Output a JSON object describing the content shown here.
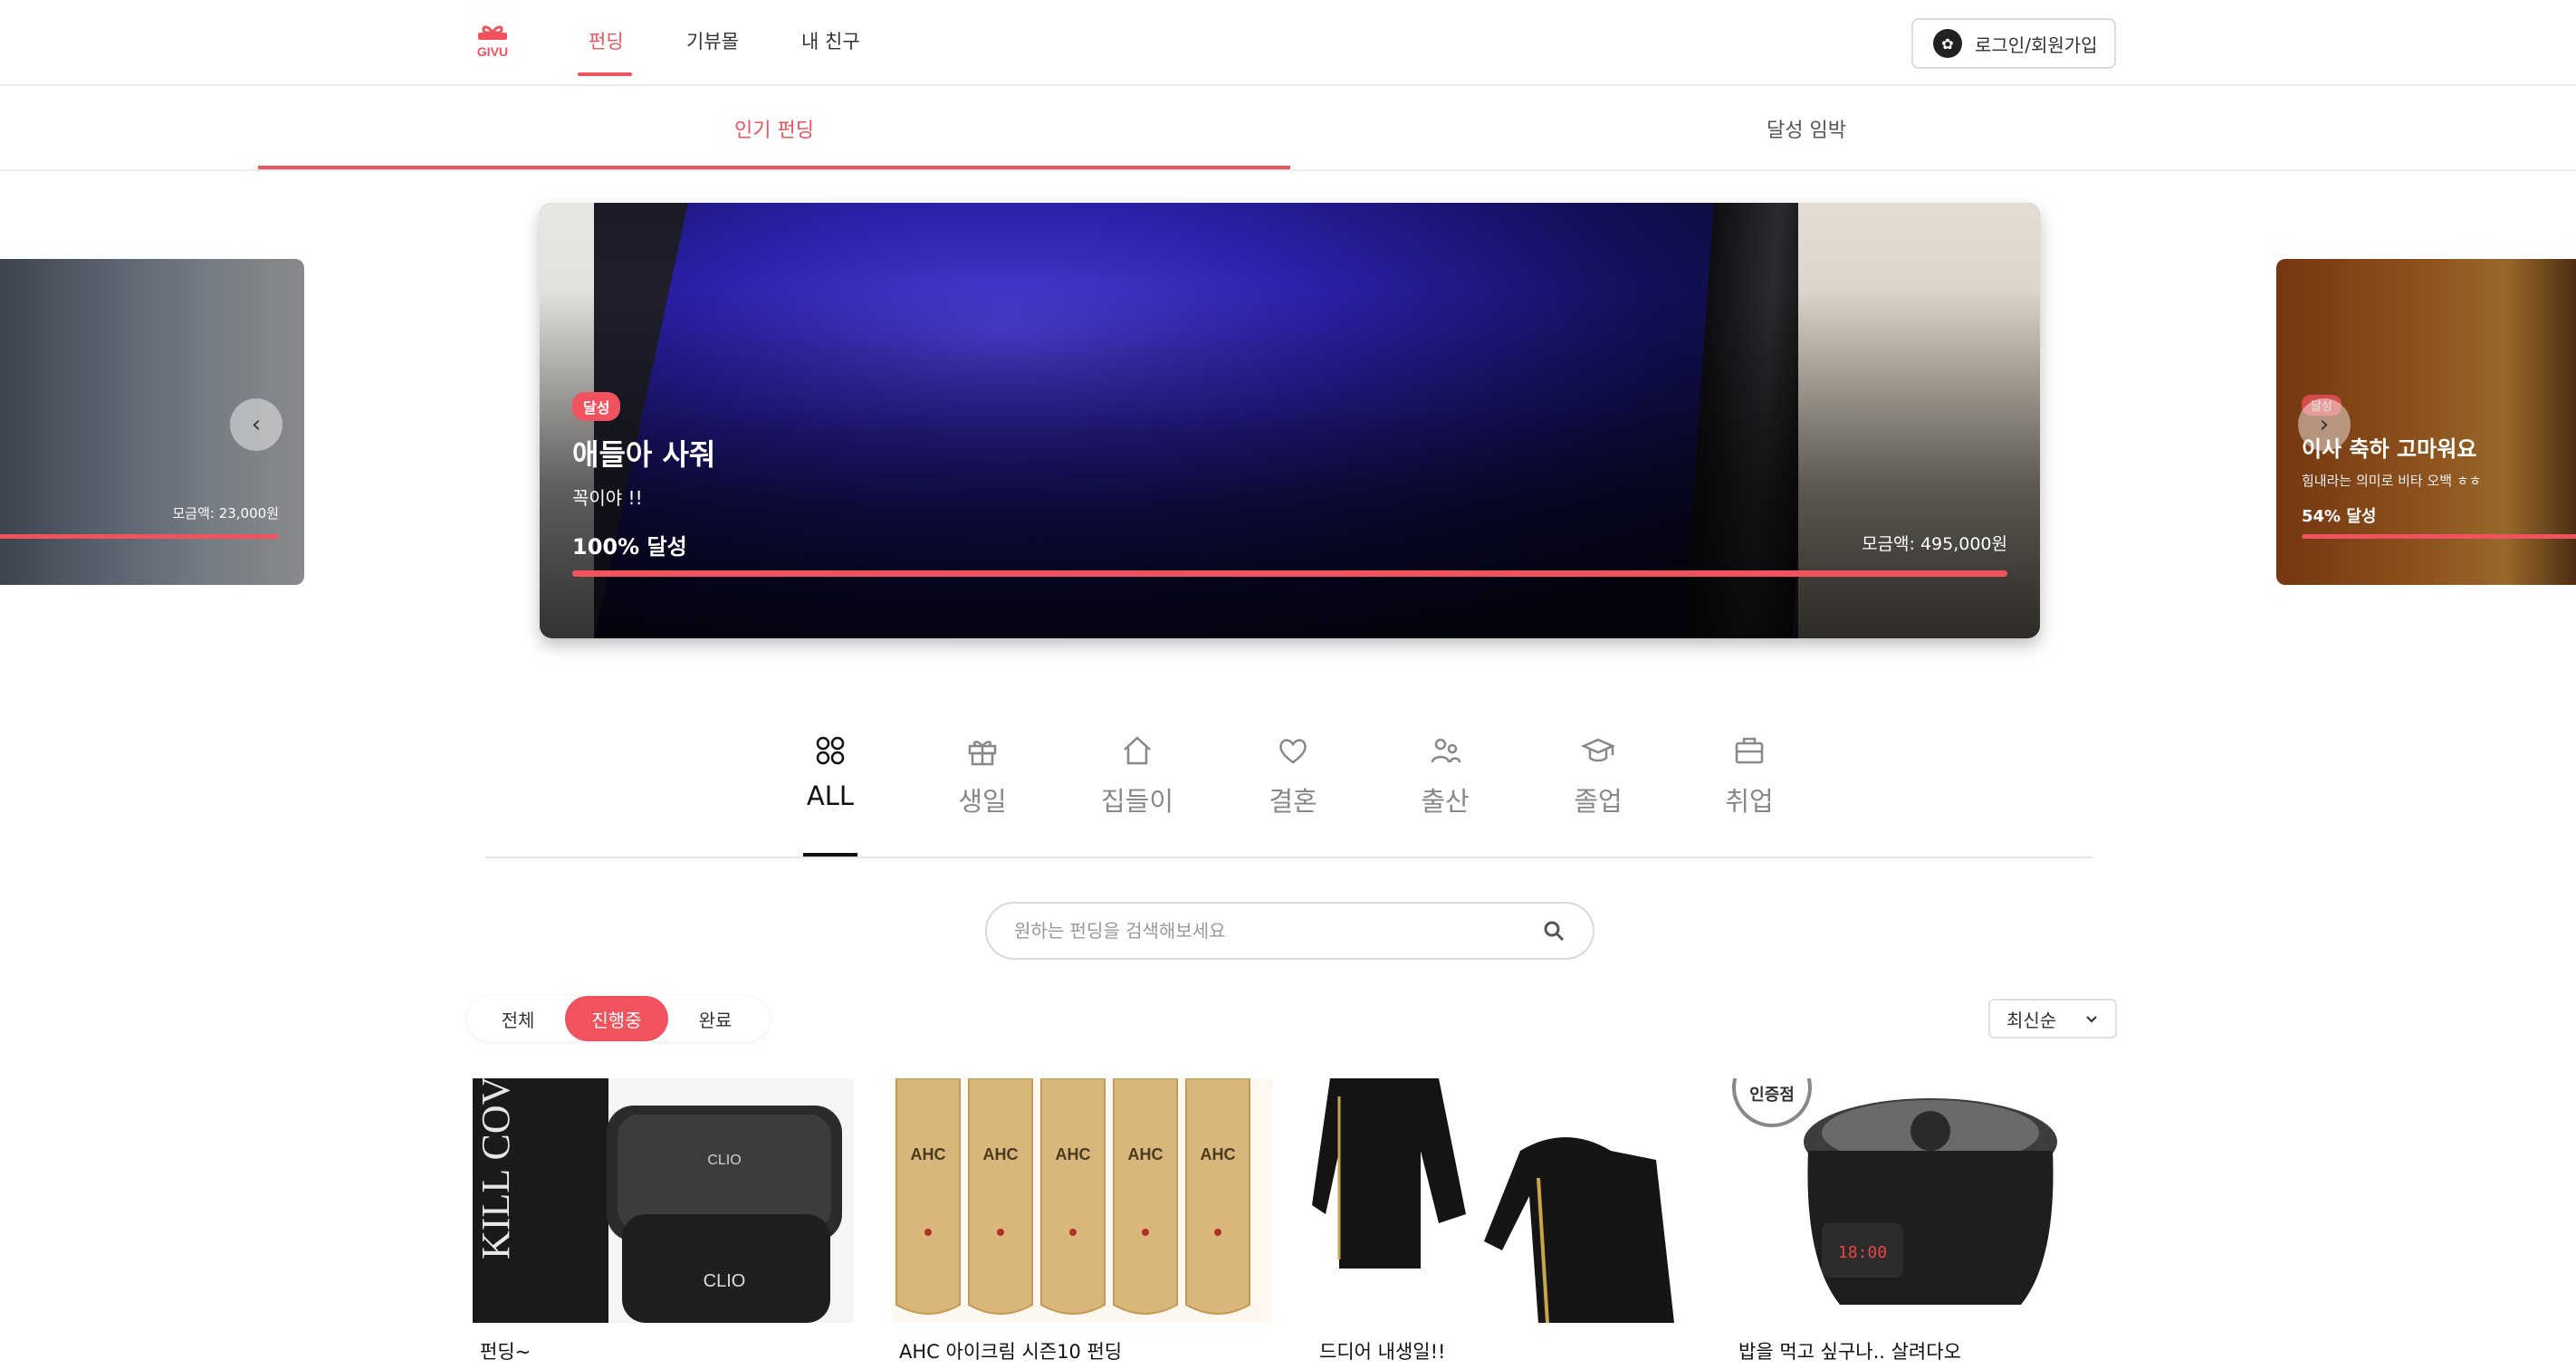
{
  "header": {
    "logo_text": "GIVU",
    "nav": [
      {
        "label": "펀딩",
        "active": true
      },
      {
        "label": "기뷰몰",
        "active": false
      },
      {
        "label": "내 친구",
        "active": false
      }
    ],
    "login_label": "로그인/회원가입"
  },
  "tabs": [
    {
      "label": "인기 펀딩",
      "active": true
    },
    {
      "label": "달성 임박",
      "active": false
    }
  ],
  "carousel": {
    "left_card": {
      "amount": "모금액: 23,000원",
      "progress_percent": 100
    },
    "main_card": {
      "badge": "달성",
      "title": "애들아 사줘",
      "subtitle": "꼭이야 !!",
      "progress_text": "100% 달성",
      "amount": "모금액: 495,000원",
      "progress_percent": 100
    },
    "right_card": {
      "badge": "달성",
      "title": "이사 축하 고마워요",
      "subtitle": "힘내라는 의미로 비타 오백 ㅎㅎ",
      "progress_text": "54% 달성",
      "progress_percent": 54
    },
    "prev_icon": "chevron-left-icon",
    "next_icon": "chevron-right-icon"
  },
  "categories": [
    {
      "label": "ALL",
      "icon": "grid-icon",
      "active": true
    },
    {
      "label": "생일",
      "icon": "gift-icon",
      "active": false
    },
    {
      "label": "집들이",
      "icon": "house-icon",
      "active": false
    },
    {
      "label": "결혼",
      "icon": "heart-icon",
      "active": false
    },
    {
      "label": "출산",
      "icon": "people-icon",
      "active": false
    },
    {
      "label": "졸업",
      "icon": "graduation-cap-icon",
      "active": false
    },
    {
      "label": "취업",
      "icon": "briefcase-icon",
      "active": false
    }
  ],
  "search": {
    "placeholder": "원하는 펀딩을 검색해보세요"
  },
  "filters": [
    {
      "label": "전체",
      "active": false
    },
    {
      "label": "진행중",
      "active": true
    },
    {
      "label": "완료",
      "active": false
    }
  ],
  "sort": {
    "selected": "최신순"
  },
  "products": [
    {
      "title": "펀딩~"
    },
    {
      "title": "AHC 아이크림 시즌10 펀딩"
    },
    {
      "title": "드디어 내생일!!"
    },
    {
      "title": "밥을 먹고 싶구나.. 살려다오"
    }
  ],
  "colors": {
    "accent": "#f0525e",
    "text": "#222222",
    "border": "#ececec"
  }
}
